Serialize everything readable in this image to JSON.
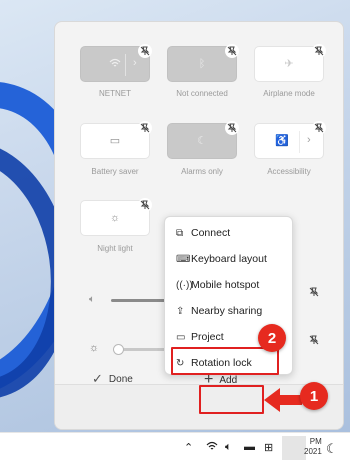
{
  "quick_settings": {
    "tiles": [
      {
        "label": "NETNET",
        "icon": "wifi-icon",
        "active": true,
        "has_chevron": true
      },
      {
        "label": "Not connected",
        "icon": "bluetooth-icon",
        "active": true,
        "has_chevron": false
      },
      {
        "label": "Airplane mode",
        "icon": "airplane-icon",
        "active": false,
        "has_chevron": false
      },
      {
        "label": "Battery saver",
        "icon": "battery-saver-icon",
        "active": false,
        "has_chevron": false
      },
      {
        "label": "Alarms only",
        "icon": "moon-icon",
        "active": true,
        "has_chevron": false
      },
      {
        "label": "Accessibility",
        "icon": "accessibility-icon",
        "active": false,
        "has_chevron": true
      },
      {
        "label": "Night light",
        "icon": "brightness-icon",
        "active": false,
        "has_chevron": false
      }
    ],
    "volume_level": 0.55,
    "brightness_level": 0.05,
    "done_label": "Done",
    "add_label": "Add"
  },
  "add_menu": {
    "items": [
      {
        "label": "Connect",
        "icon": "cast-icon"
      },
      {
        "label": "Keyboard layout",
        "icon": "keyboard-layout-icon"
      },
      {
        "label": "Mobile hotspot",
        "icon": "hotspot-icon"
      },
      {
        "label": "Nearby sharing",
        "icon": "nearby-sharing-icon"
      },
      {
        "label": "Project",
        "icon": "project-icon"
      },
      {
        "label": "Rotation lock",
        "icon": "rotation-lock-icon"
      }
    ]
  },
  "annotations": {
    "step_1": "1",
    "step_2": "2",
    "highlight_color": "#e02020",
    "badge_color": "#e62a1f"
  },
  "taskbar": {
    "time": "PM",
    "date": "2021"
  }
}
